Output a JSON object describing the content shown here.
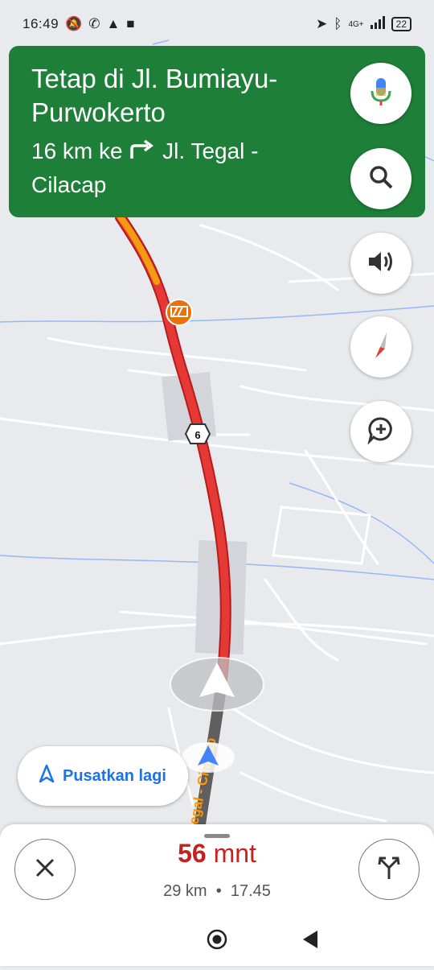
{
  "status": {
    "time": "16:49",
    "network": "4G+",
    "battery": "22"
  },
  "banner": {
    "title": "Tetap di Jl. Bumiayu-Purwokerto",
    "distance": "16 km ke",
    "turn_icon": "turn-right-icon",
    "next_road": "Jl. Tegal - Cilacap"
  },
  "map": {
    "road_shield": "6",
    "road_label": "egal - Cilacap"
  },
  "buttons": {
    "recenter_label": "Pusatkan lagi"
  },
  "trip": {
    "eta_value": "56",
    "eta_unit": "mnt",
    "distance": "29 km",
    "separator": "•",
    "arrival": "17.45"
  },
  "colors": {
    "banner": "#1e7f38",
    "traffic_heavy": "#e53935",
    "traffic_medium": "#f39c12",
    "eta": "#c5221f",
    "accent": "#1a73e8"
  }
}
